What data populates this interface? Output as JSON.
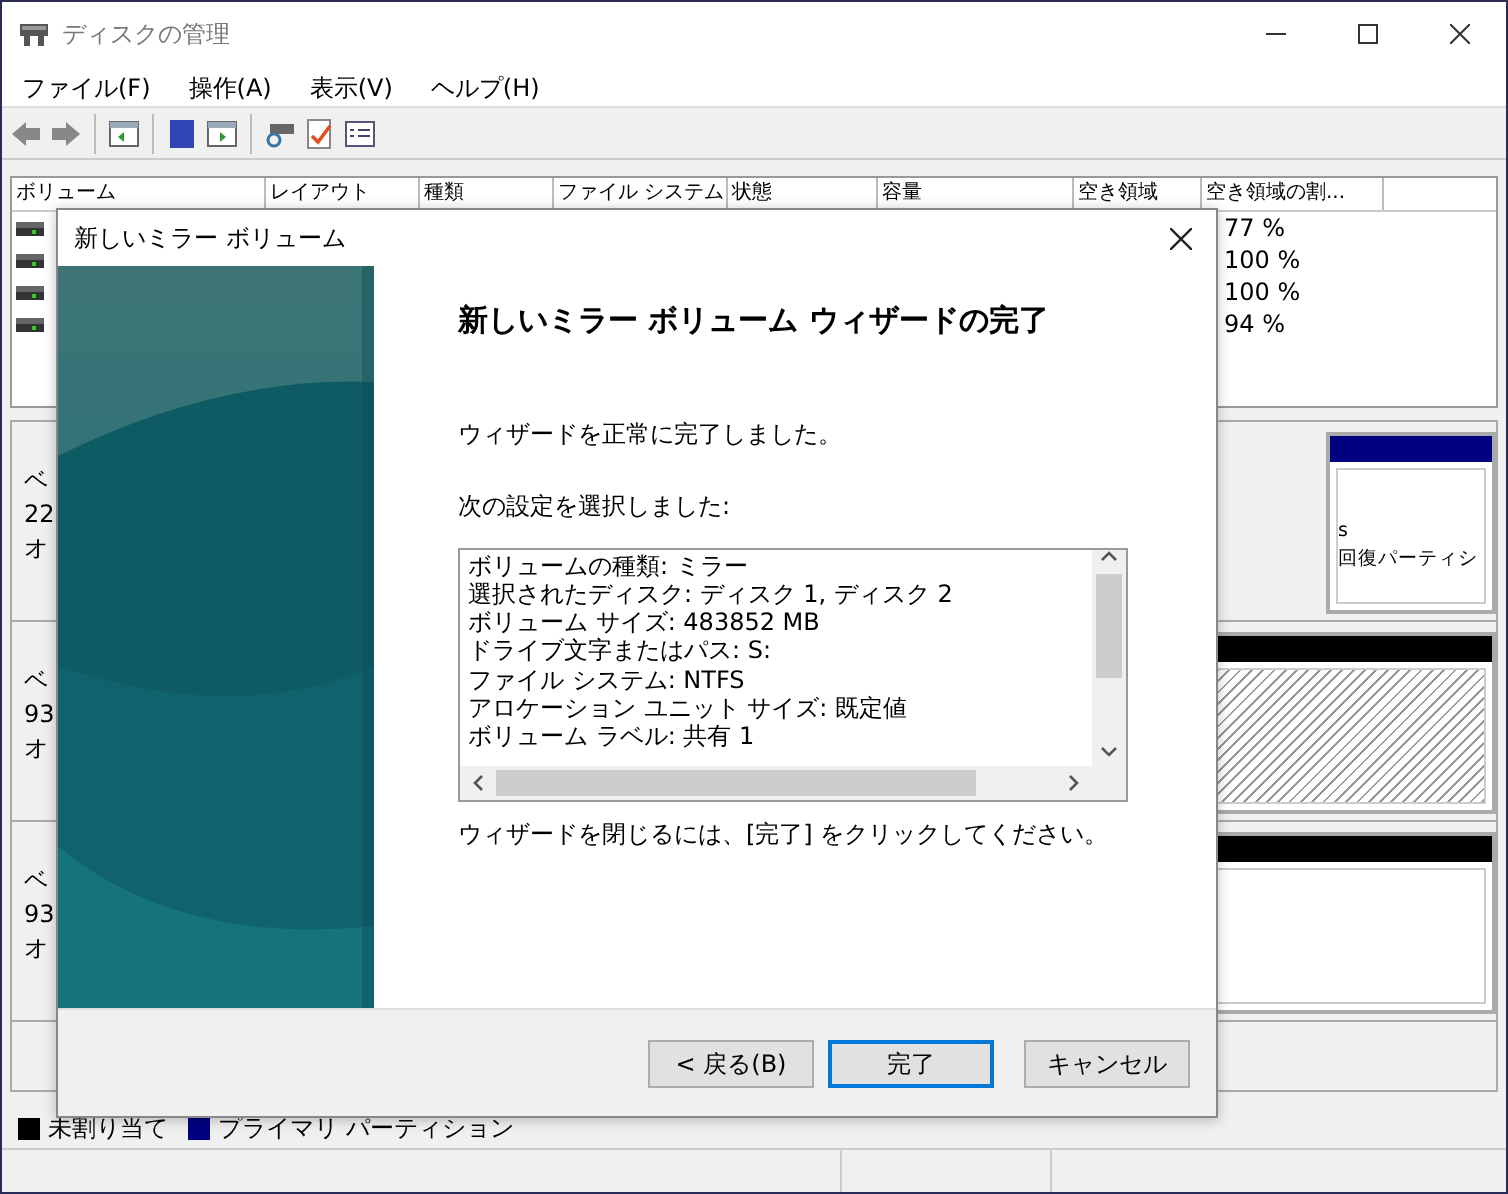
{
  "window": {
    "title": "ディスクの管理"
  },
  "menu": [
    "ファイル(F)",
    "操作(A)",
    "表示(V)",
    "ヘルプ(H)"
  ],
  "volume_table": {
    "columns": [
      "ボリューム",
      "レイアウト",
      "種類",
      "ファイル システム",
      "状態",
      "容量",
      "空き領域",
      "空き領域の割..."
    ],
    "rows": [
      {
        "free_percent": "77 %"
      },
      {
        "free_percent": "100 %"
      },
      {
        "free_percent": "100 %"
      },
      {
        "free_percent": "94 %"
      }
    ]
  },
  "disks": [
    {
      "labels": [
        "ベ",
        "22",
        "オ"
      ],
      "partition": {
        "color": "#000080",
        "hatched": false,
        "texts": [
          "s",
          "回復パーティシ"
        ]
      }
    },
    {
      "labels": [
        "ベ",
        "93",
        "オ"
      ],
      "partition": {
        "color": "#000000",
        "hatched": true
      }
    },
    {
      "labels": [
        "ベ",
        "93",
        "オ"
      ],
      "partition": {
        "color": "#000000",
        "hatched": false
      }
    }
  ],
  "legend": [
    {
      "label": "未割り当て",
      "color": "#000000"
    },
    {
      "label": "プライマリ パーティション",
      "color": "#000080"
    }
  ],
  "dialog": {
    "title": "新しいミラー ボリューム",
    "heading": "新しいミラー ボリューム ウィザードの完了",
    "intro": "ウィザードを正常に完了しました。",
    "list_label": "次の設定を選択しました:",
    "summary_lines": [
      "ボリュームの種類: ミラー",
      "選択されたディスク: ディスク 1, ディスク 2",
      "ボリューム サイズ: 483852 MB",
      "ドライブ文字またはパス: S:",
      "ファイル システム: NTFS",
      "アロケーション ユニット サイズ: 既定値",
      "ボリューム ラベル: 共有 1"
    ],
    "footer_text": "ウィザードを閉じるには、[完了] をクリックしてください。",
    "buttons": [
      {
        "label": "< 戻る(B)",
        "default": false
      },
      {
        "label": "完了",
        "default": true
      },
      {
        "label": "キャンセル",
        "default": false
      }
    ]
  }
}
